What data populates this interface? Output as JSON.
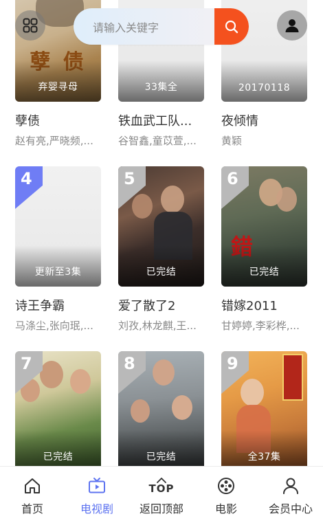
{
  "header": {
    "search_placeholder": "请输入关键字"
  },
  "items": [
    {
      "title": "孽债",
      "cast": "赵有亮,严晓频,...",
      "status": "弃婴寻母",
      "poster_text": "孽 债"
    },
    {
      "title": "铁血武工队...",
      "cast": "谷智鑫,童苡萱,...",
      "status": "33集全"
    },
    {
      "title": "夜倾情",
      "cast": "黄颖",
      "status": "20170118"
    },
    {
      "rank": "4",
      "title": "诗王争霸",
      "cast": "马涤尘,张向珉,...",
      "status": "更新至3集"
    },
    {
      "rank": "5",
      "title": "爱了散了2",
      "cast": "刘孜,林龙麒,王...",
      "status": "已完结"
    },
    {
      "rank": "6",
      "title": "错嫁2011",
      "cast": "甘婷婷,李彩桦,...",
      "status": "已完结"
    },
    {
      "rank": "7",
      "title": "",
      "cast": "",
      "status": "已完结"
    },
    {
      "rank": "8",
      "title": "",
      "cast": "",
      "status": "已完结"
    },
    {
      "rank": "9",
      "title": "",
      "cast": "",
      "status": "全37集"
    }
  ],
  "tabs": [
    {
      "label": "首页",
      "icon": "home-icon"
    },
    {
      "label": "电视剧",
      "icon": "tv-icon",
      "active": true
    },
    {
      "label": "返回顶部",
      "icon": "top-arrow-icon",
      "icon_text": "TOP"
    },
    {
      "label": "电影",
      "icon": "film-reel-icon"
    },
    {
      "label": "会员中心",
      "icon": "user-icon"
    }
  ],
  "colors": {
    "accent": "#5d73f0",
    "search_button": "#f4511e",
    "rank_first": "#6f7df5"
  }
}
